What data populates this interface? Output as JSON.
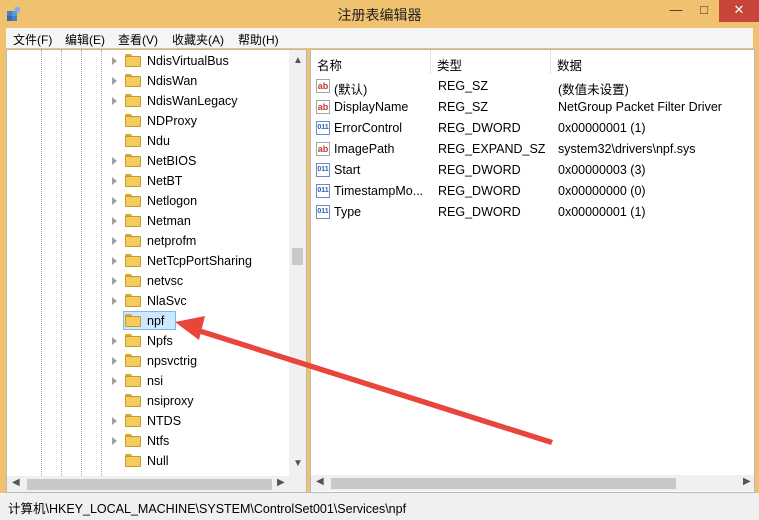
{
  "window": {
    "title": "注册表编辑器"
  },
  "icons": {
    "app": "registry-editor-icon",
    "minimize": "minimize-icon",
    "maximize": "maximize-icon",
    "close": "close-icon"
  },
  "menu": [
    {
      "label": "文件(F)"
    },
    {
      "label": "编辑(E)"
    },
    {
      "label": "查看(V)"
    },
    {
      "label": "收藏夹(A)"
    },
    {
      "label": "帮助(H)"
    }
  ],
  "tree": {
    "items": [
      {
        "label": "NdisVirtualBus",
        "expandable": true
      },
      {
        "label": "NdisWan",
        "expandable": true
      },
      {
        "label": "NdisWanLegacy",
        "expandable": true
      },
      {
        "label": "NDProxy",
        "expandable": false
      },
      {
        "label": "Ndu",
        "expandable": false
      },
      {
        "label": "NetBIOS",
        "expandable": true
      },
      {
        "label": "NetBT",
        "expandable": true
      },
      {
        "label": "Netlogon",
        "expandable": true
      },
      {
        "label": "Netman",
        "expandable": true
      },
      {
        "label": "netprofm",
        "expandable": true
      },
      {
        "label": "NetTcpPortSharing",
        "expandable": true
      },
      {
        "label": "netvsc",
        "expandable": true
      },
      {
        "label": "NlaSvc",
        "expandable": true
      },
      {
        "label": "npf",
        "expandable": false,
        "selected": true
      },
      {
        "label": "Npfs",
        "expandable": true
      },
      {
        "label": "npsvctrig",
        "expandable": true
      },
      {
        "label": "nsi",
        "expandable": true
      },
      {
        "label": "nsiproxy",
        "expandable": false
      },
      {
        "label": "NTDS",
        "expandable": true
      },
      {
        "label": "Ntfs",
        "expandable": true
      },
      {
        "label": "Null",
        "expandable": false
      }
    ]
  },
  "values": {
    "columns": [
      "名称",
      "类型",
      "数据"
    ],
    "rows": [
      {
        "icon": "string-value-icon",
        "name": "(默认)",
        "type": "REG_SZ",
        "data": "(数值未设置)"
      },
      {
        "icon": "string-value-icon",
        "name": "DisplayName",
        "type": "REG_SZ",
        "data": "NetGroup Packet Filter Driver"
      },
      {
        "icon": "binary-value-icon",
        "name": "ErrorControl",
        "type": "REG_DWORD",
        "data": "0x00000001 (1)"
      },
      {
        "icon": "string-value-icon",
        "name": "ImagePath",
        "type": "REG_EXPAND_SZ",
        "data": "system32\\drivers\\npf.sys"
      },
      {
        "icon": "binary-value-icon",
        "name": "Start",
        "type": "REG_DWORD",
        "data": "0x00000003 (3)"
      },
      {
        "icon": "binary-value-icon",
        "name": "TimestampMo...",
        "type": "REG_DWORD",
        "data": "0x00000000 (0)"
      },
      {
        "icon": "binary-value-icon",
        "name": "Type",
        "type": "REG_DWORD",
        "data": "0x00000001 (1)"
      }
    ]
  },
  "status": {
    "path": "计算机\\HKEY_LOCAL_MACHINE\\SYSTEM\\ControlSet001\\Services\\npf"
  },
  "colors": {
    "frame": "#f0c270",
    "close": "#c7453a",
    "selection": "#cde8ff",
    "arrow": "#e8453c"
  }
}
